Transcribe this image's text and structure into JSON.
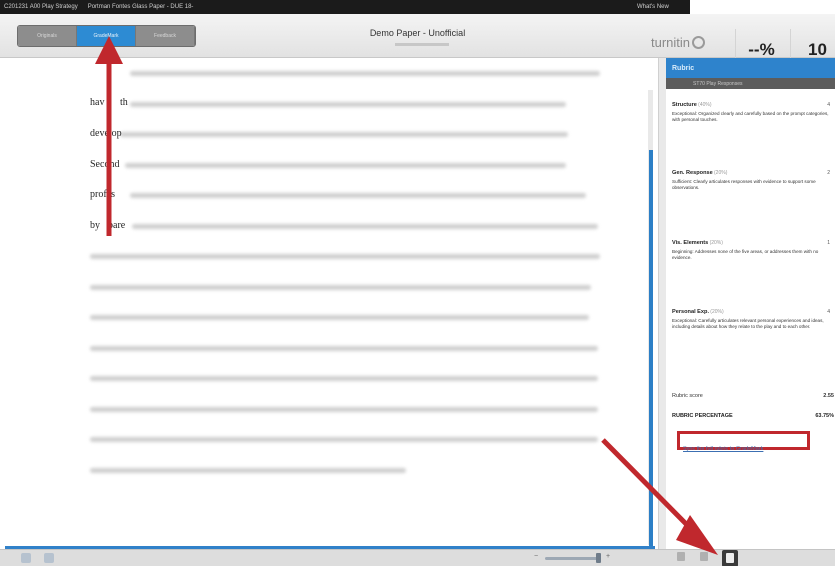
{
  "topbar": {
    "crumb_1": "C201231 A00 Play Strategy",
    "crumb_2": "Portman Fontes Glass Paper - DUE 18-",
    "whats_new": "What's New"
  },
  "header": {
    "modes": [
      "Originals",
      "GradeMark",
      "Feedback"
    ],
    "active_mode": "GradeMark",
    "doc_title": "Demo Paper - Unofficial",
    "brand": "turnitin",
    "similarity": "--%",
    "page_count": "10"
  },
  "document": {
    "visible_fragments": [
      "hav",
      "th",
      "develop",
      "Second",
      "profes",
      "by",
      "pare"
    ]
  },
  "rubric": {
    "title": "Rubric",
    "subtitle": "ST70 Play Responses",
    "criteria": [
      {
        "name": "Structure",
        "weight": "(40%)",
        "points": "4",
        "description": "Exceptional: Organized clearly and carefully based on the prompt categories, with personal touches."
      },
      {
        "name": "Gen. Response",
        "weight": "(20%)",
        "points": "2",
        "description": "Sufficient: Clearly articulates responses with evidence to support some observations."
      },
      {
        "name": "Vis. Elements",
        "weight": "(20%)",
        "points": "1",
        "description": "Beginning: Addresses none of the five areas, or addresses them with no evidence."
      },
      {
        "name": "Personal Exp.",
        "weight": "(20%)",
        "points": "4",
        "description": "Exceptional: Carefully articulates relevant personal experiences and ideas, including details about how they relate to the play and to each other."
      }
    ],
    "score_label": "Rubric score",
    "score_value": "2.55",
    "percentage_label": "RUBRIC PERCENTAGE",
    "percentage_value": "63.75%",
    "link_text": "Sync the full rubric to GradeMark"
  },
  "colors": {
    "accent_blue": "#2e83cc",
    "annotation_red": "#c0282d",
    "highlight_box": "#c0282d"
  }
}
